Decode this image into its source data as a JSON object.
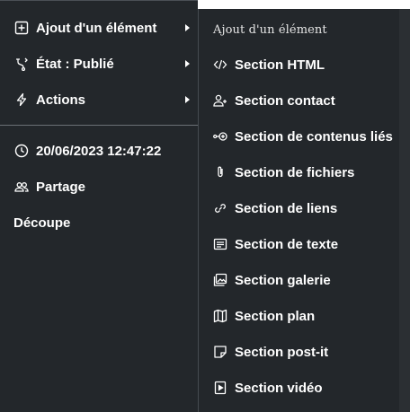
{
  "main_menu": {
    "items": [
      {
        "label": "Ajout d'un élément",
        "icon": "plus-square-icon"
      },
      {
        "label": "État : Publié",
        "icon": "workflow-icon"
      },
      {
        "label": "Actions",
        "icon": "lightning-icon"
      }
    ],
    "info": [
      {
        "label": "20/06/2023 12:47:22",
        "icon": "clock-icon"
      },
      {
        "label": "Partage",
        "icon": "users-icon"
      },
      {
        "label": "Découpe",
        "icon": ""
      }
    ]
  },
  "submenu": {
    "title": "Ajout d'un élément",
    "items": [
      {
        "label": "Section HTML",
        "icon": "code-icon"
      },
      {
        "label": "Section contact",
        "icon": "user-plus-icon"
      },
      {
        "label": "Section de contenus liés",
        "icon": "linked-content-icon"
      },
      {
        "label": "Section de fichiers",
        "icon": "paperclip-icon"
      },
      {
        "label": "Section de liens",
        "icon": "link-icon"
      },
      {
        "label": "Section de texte",
        "icon": "text-icon"
      },
      {
        "label": "Section galerie",
        "icon": "gallery-icon"
      },
      {
        "label": "Section plan",
        "icon": "map-icon"
      },
      {
        "label": "Section post-it",
        "icon": "sticky-note-icon"
      },
      {
        "label": "Section vidéo",
        "icon": "video-icon"
      }
    ]
  },
  "colors": {
    "panel_bg": "#23272b",
    "text": "#ffffff",
    "divider": "#6b7076"
  }
}
